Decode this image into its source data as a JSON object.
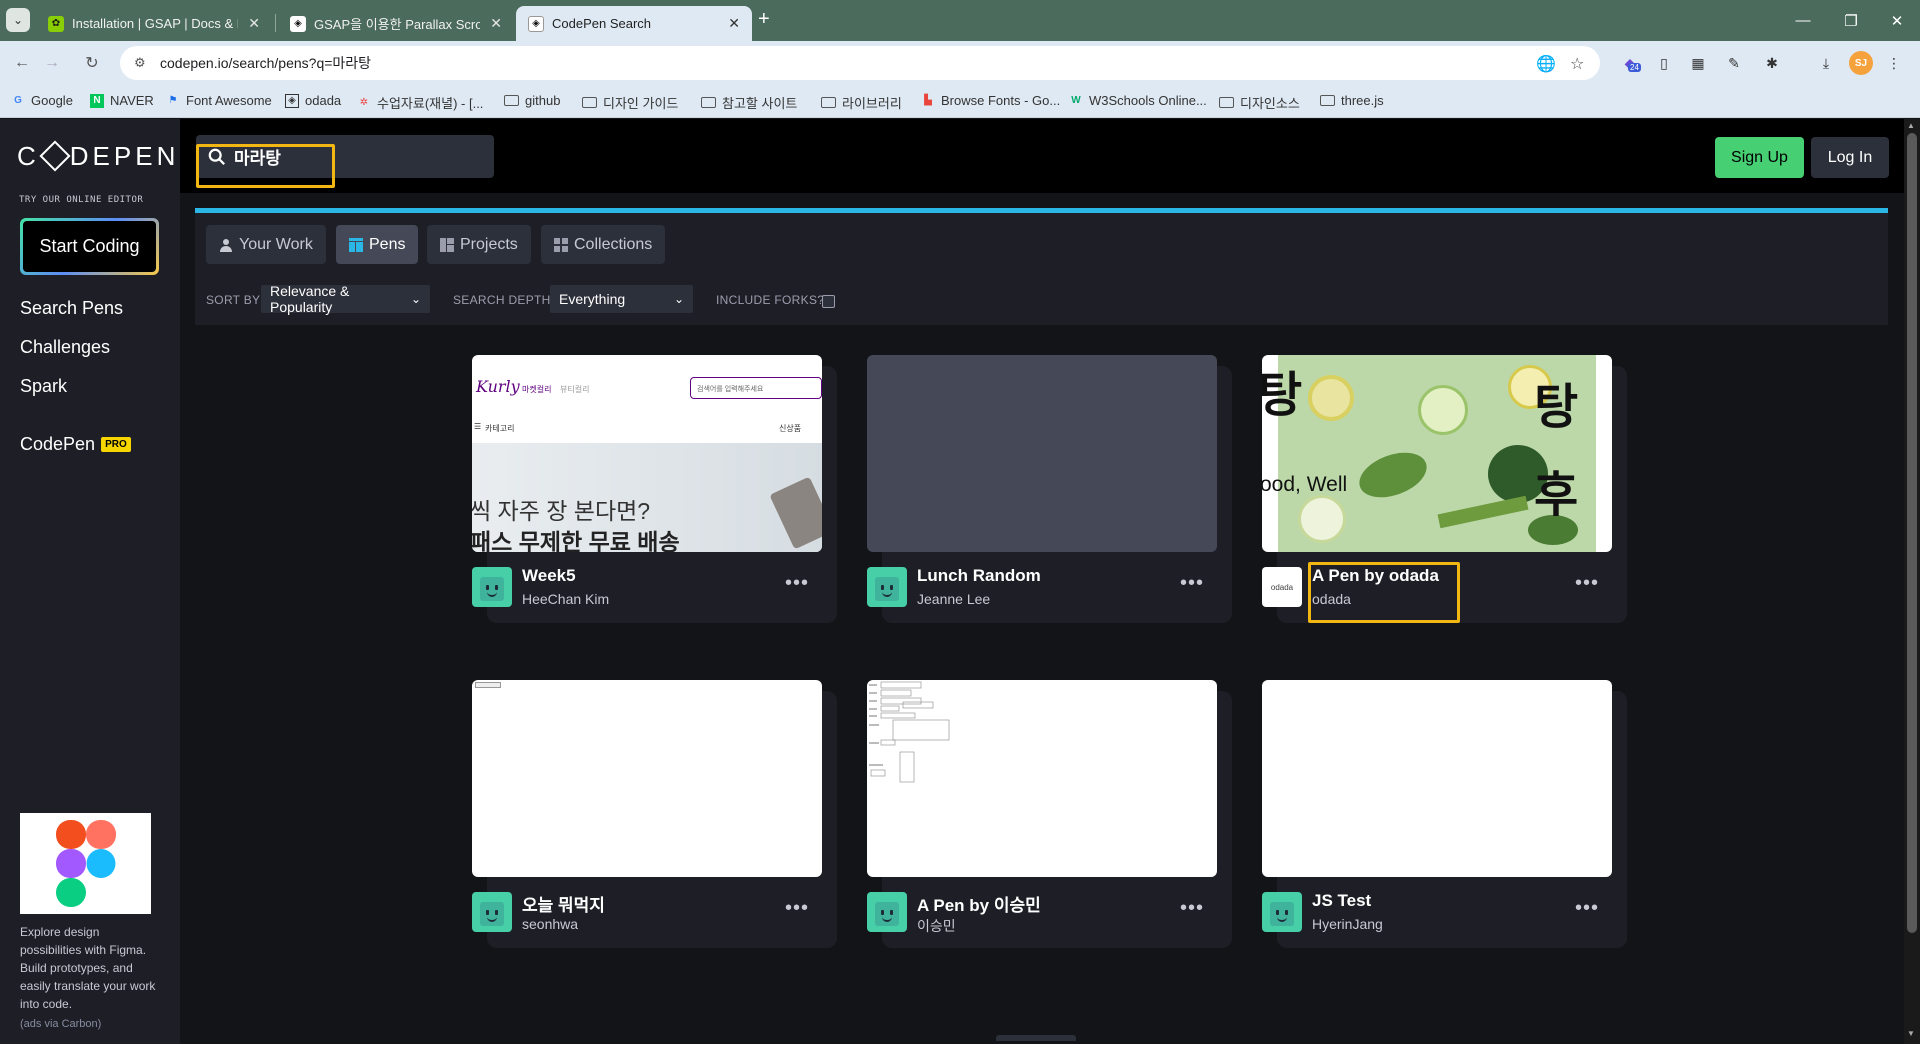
{
  "browser": {
    "tabs": [
      {
        "title": "Installation | GSAP | Docs & Le",
        "favicon": "gsap-icon"
      },
      {
        "title": "GSAP을 이용한 Parallax Scrollin",
        "favicon": "codepen-icon"
      },
      {
        "title": "CodePen Search",
        "favicon": "codepen-icon",
        "active": true
      }
    ],
    "url": "codepen.io/search/pens?q=마라탕",
    "extension_badge": "24",
    "profile_initials": "SJ",
    "bookmarks": [
      {
        "label": "Google",
        "type": "site"
      },
      {
        "label": "NAVER",
        "type": "site"
      },
      {
        "label": "Font Awesome",
        "type": "site"
      },
      {
        "label": "odada",
        "type": "site"
      },
      {
        "label": "수업자료(재녈) - [...",
        "type": "site"
      },
      {
        "label": "github",
        "type": "folder"
      },
      {
        "label": "디자인 가이드",
        "type": "folder"
      },
      {
        "label": "참고할 사이트",
        "type": "folder"
      },
      {
        "label": "라이브러리",
        "type": "folder"
      },
      {
        "label": "Browse Fonts - Go...",
        "type": "site"
      },
      {
        "label": "W3Schools Online...",
        "type": "site"
      },
      {
        "label": "디자인소스",
        "type": "folder"
      },
      {
        "label": "three.js",
        "type": "folder"
      }
    ]
  },
  "sidebar": {
    "logo": "CODEPEN",
    "logo_left": "C",
    "logo_right": "DEPEN",
    "try_label": "TRY OUR ONLINE EDITOR",
    "start_coding": "Start Coding",
    "nav": [
      "Search Pens",
      "Challenges",
      "Spark"
    ],
    "codepen_pro": "CodePen",
    "pro_badge": "PRO",
    "ad_text": "Explore design possibilities with Figma. Build prototypes, and easily translate your work into code.",
    "ad_via": "(ads via Carbon)"
  },
  "header": {
    "search_value": "마라탕",
    "signup": "Sign Up",
    "login": "Log In"
  },
  "filters": {
    "tabs": [
      "Your Work",
      "Pens",
      "Projects",
      "Collections"
    ],
    "active_tab": "Pens",
    "sort_by_label": "SORT BY",
    "sort_by_value": "Relevance & Popularity",
    "depth_label": "SEARCH DEPTH",
    "depth_value": "Everything",
    "forks_label": "INCLUDE FORKS?"
  },
  "pens": [
    {
      "title": "Week5",
      "user": "HeeChan Kim"
    },
    {
      "title": "Lunch Random",
      "user": "Jeanne Lee"
    },
    {
      "title": "A Pen by odada",
      "user": "odada"
    },
    {
      "title": "오늘 뭐먹지",
      "user": "seonhwa"
    },
    {
      "title": "A Pen by 이승민",
      "user": "이승민"
    },
    {
      "title": "JS Test",
      "user": "HyerinJang"
    }
  ],
  "thumb_text": {
    "kurly_logo": "Kurly",
    "kurly_tab1": "마켓컬리",
    "kurly_tab2": "뷰티컬리",
    "kurly_search": "검색어를 입력해주세요",
    "kurly_category": "카테고리",
    "kurly_new": "신상품",
    "kurly_headline1": "씩 자주 장 본다면?",
    "kurly_headline2": "패스 무제한 무료 배송",
    "odada_char1": "탕",
    "odada_char2": "후",
    "odada_char_left": "탕",
    "odada_text": "ood, Well",
    "odada_avatar": "odada"
  },
  "colors": {
    "accent_green": "#47cf73",
    "highlight": "#f3b713",
    "filter_border": "#2bb7e6"
  }
}
